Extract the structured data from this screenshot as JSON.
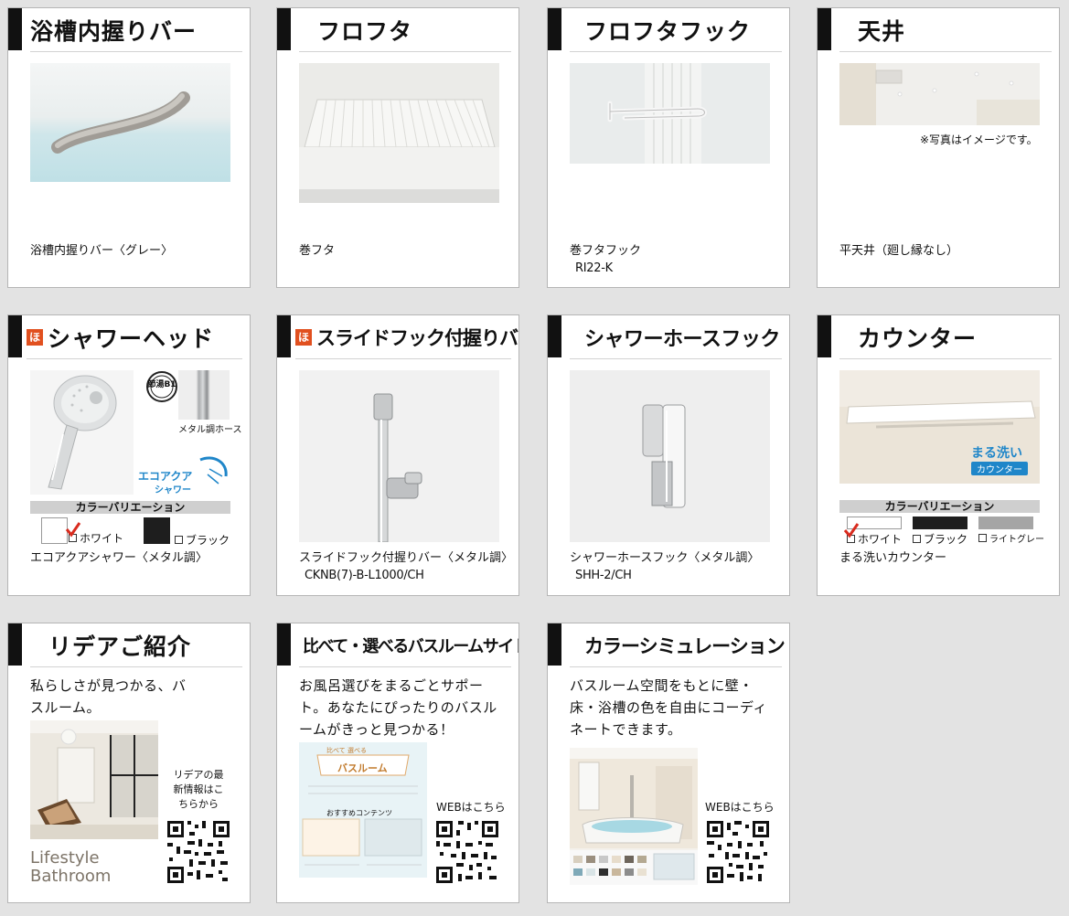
{
  "cards": {
    "grab_bar": {
      "title": "浴槽内握りバー",
      "caption": "浴槽内握りバー〈グレー〉"
    },
    "lid": {
      "title": "フロフタ",
      "caption": "巻フタ"
    },
    "lid_hook": {
      "title": "フロフタフック",
      "caption": "巻フタフック",
      "model": "RI22-K"
    },
    "ceiling": {
      "title": "天井",
      "note": "※写真はイメージです。",
      "caption": "平天井（廻し縁なし）"
    },
    "shower_head": {
      "title": "シャワーヘッド",
      "badge": "ほ",
      "seal": "節湯B1",
      "hose_label": "メタル調ホース",
      "logo_line1": "エコアクア",
      "logo_line2": "シャワー",
      "variation_label": "カラーバリエーション",
      "opt_white": "ホワイト",
      "opt_black": "ブラック",
      "caption": "エコアクアシャワー〈メタル調〉",
      "swatches": [
        "#ffffff",
        "#1e1e1e"
      ]
    },
    "slide_bar": {
      "title": "スライドフック付握りバー",
      "badge": "ほ",
      "caption": "スライドフック付握りバー〈メタル調〉",
      "model": "CKNB(7)-B-L1000/CH"
    },
    "hose_hook": {
      "title": "シャワーホースフック",
      "caption": "シャワーホースフック〈メタル調〉",
      "model": "SHH-2/CH"
    },
    "counter": {
      "title": "カウンター",
      "logo_line1": "まる洗い",
      "logo_line2": "カウンター",
      "variation_label": "カラーバリエーション",
      "opt_white": "ホワイト",
      "opt_black": "ブラック",
      "opt_lightgray": "ライトグレー",
      "caption": "まる洗いカウンター",
      "swatches": [
        "#ffffff",
        "#1e1e1e",
        "#a5a5a5"
      ]
    },
    "ridea": {
      "title": "リデアご紹介",
      "desc": "私らしさが見つかる、バスルーム。",
      "qr_text": "リデアの最新情報はこちらから",
      "logo_line1": "Lifestyle",
      "logo_line2": "Bathroom"
    },
    "compare": {
      "title": "比べて・選べるバスルームサイト",
      "desc": "お風呂選びをまるごとサポート。あなたにぴったりのバスルームがきっと見つかる！",
      "web_label": "WEBはこちら",
      "thumb_banner": "バスルーム",
      "thumb_tag": "比べて 選べる",
      "thumb_section": "おすすめコンテンツ"
    },
    "color_sim": {
      "title": "カラーシミュレーション",
      "desc": "バスルーム空間をもとに壁・床・浴槽の色を自由にコーディネートできます。",
      "web_label": "WEBはこちら"
    }
  },
  "colors": {
    "accent_badge": "#e1501f",
    "check_mark": "#d92b1e",
    "logo_blue": "#1f86c9",
    "title_bar": "#111111"
  }
}
